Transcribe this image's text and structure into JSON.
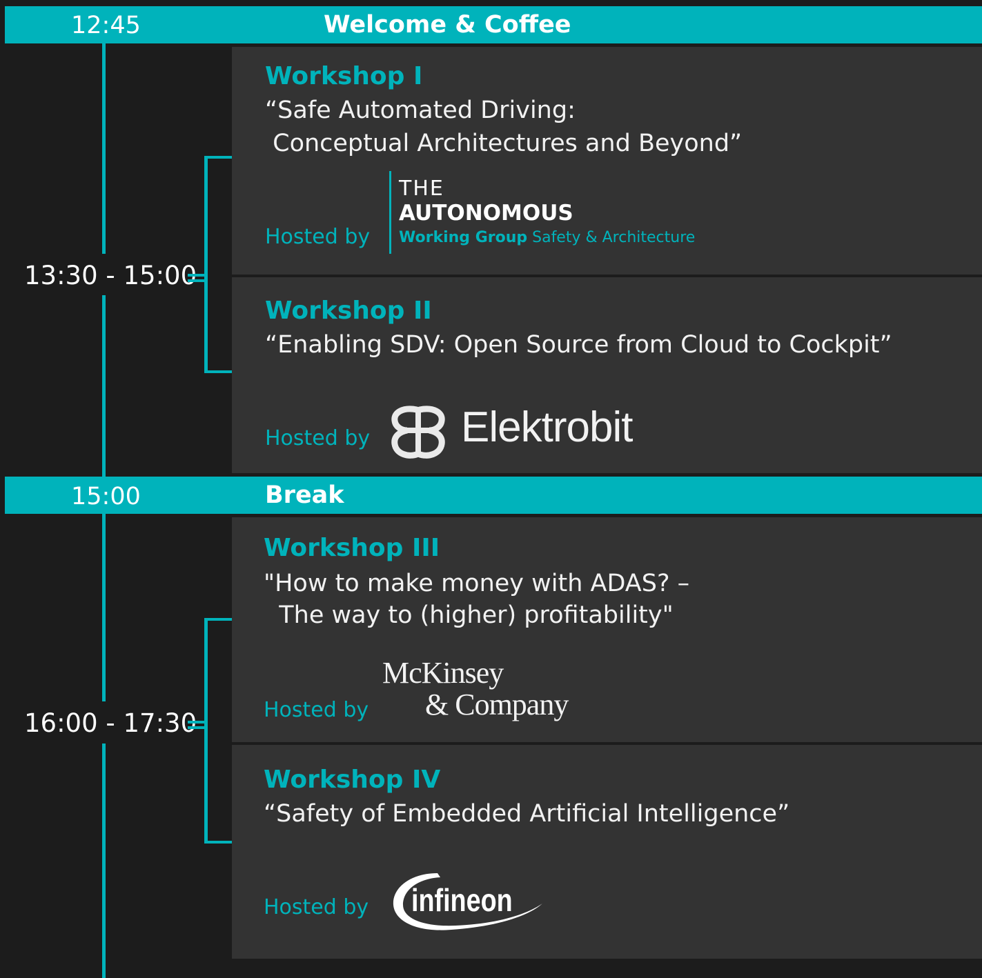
{
  "rows": {
    "welcome": {
      "time": "12:45",
      "title": "Welcome & Coffee"
    },
    "break": {
      "time": "15:00",
      "title": "Break"
    }
  },
  "slots": [
    {
      "time": "13:30 - 15:00"
    },
    {
      "time": "16:00 - 17:30"
    }
  ],
  "hosted_by_label": "Hosted by",
  "workshops": [
    {
      "label": "Workshop I",
      "title_line1": "“Safe Automated Driving:",
      "title_line2": " Conceptual Architectures and Beyond”"
    },
    {
      "label": "Workshop II",
      "title_line1": "“Enabling SDV: Open Source from Cloud to Cockpit”"
    },
    {
      "label": "Workshop III",
      "title_line1": "\"How to make money with ADAS? –",
      "title_line2": "  The way to (higher) profitability\""
    },
    {
      "label": "Workshop IV",
      "title_line1": "“Safety of Embedded Artificial Intelligence”"
    }
  ],
  "logos": {
    "autonomous": {
      "line1": "THE",
      "line2": "AUTONOMOUS",
      "line3a": "Working Group",
      "line3b": " Safety & Architecture"
    },
    "elektrobit": {
      "name": "Elektrobit"
    },
    "mckinsey": {
      "line1": "McKinsey",
      "line2": "& Company"
    },
    "infineon": {
      "name": "infineon"
    }
  },
  "colors": {
    "accent": "#00b3bb",
    "background": "#1c1c1c",
    "card": "#333333"
  }
}
